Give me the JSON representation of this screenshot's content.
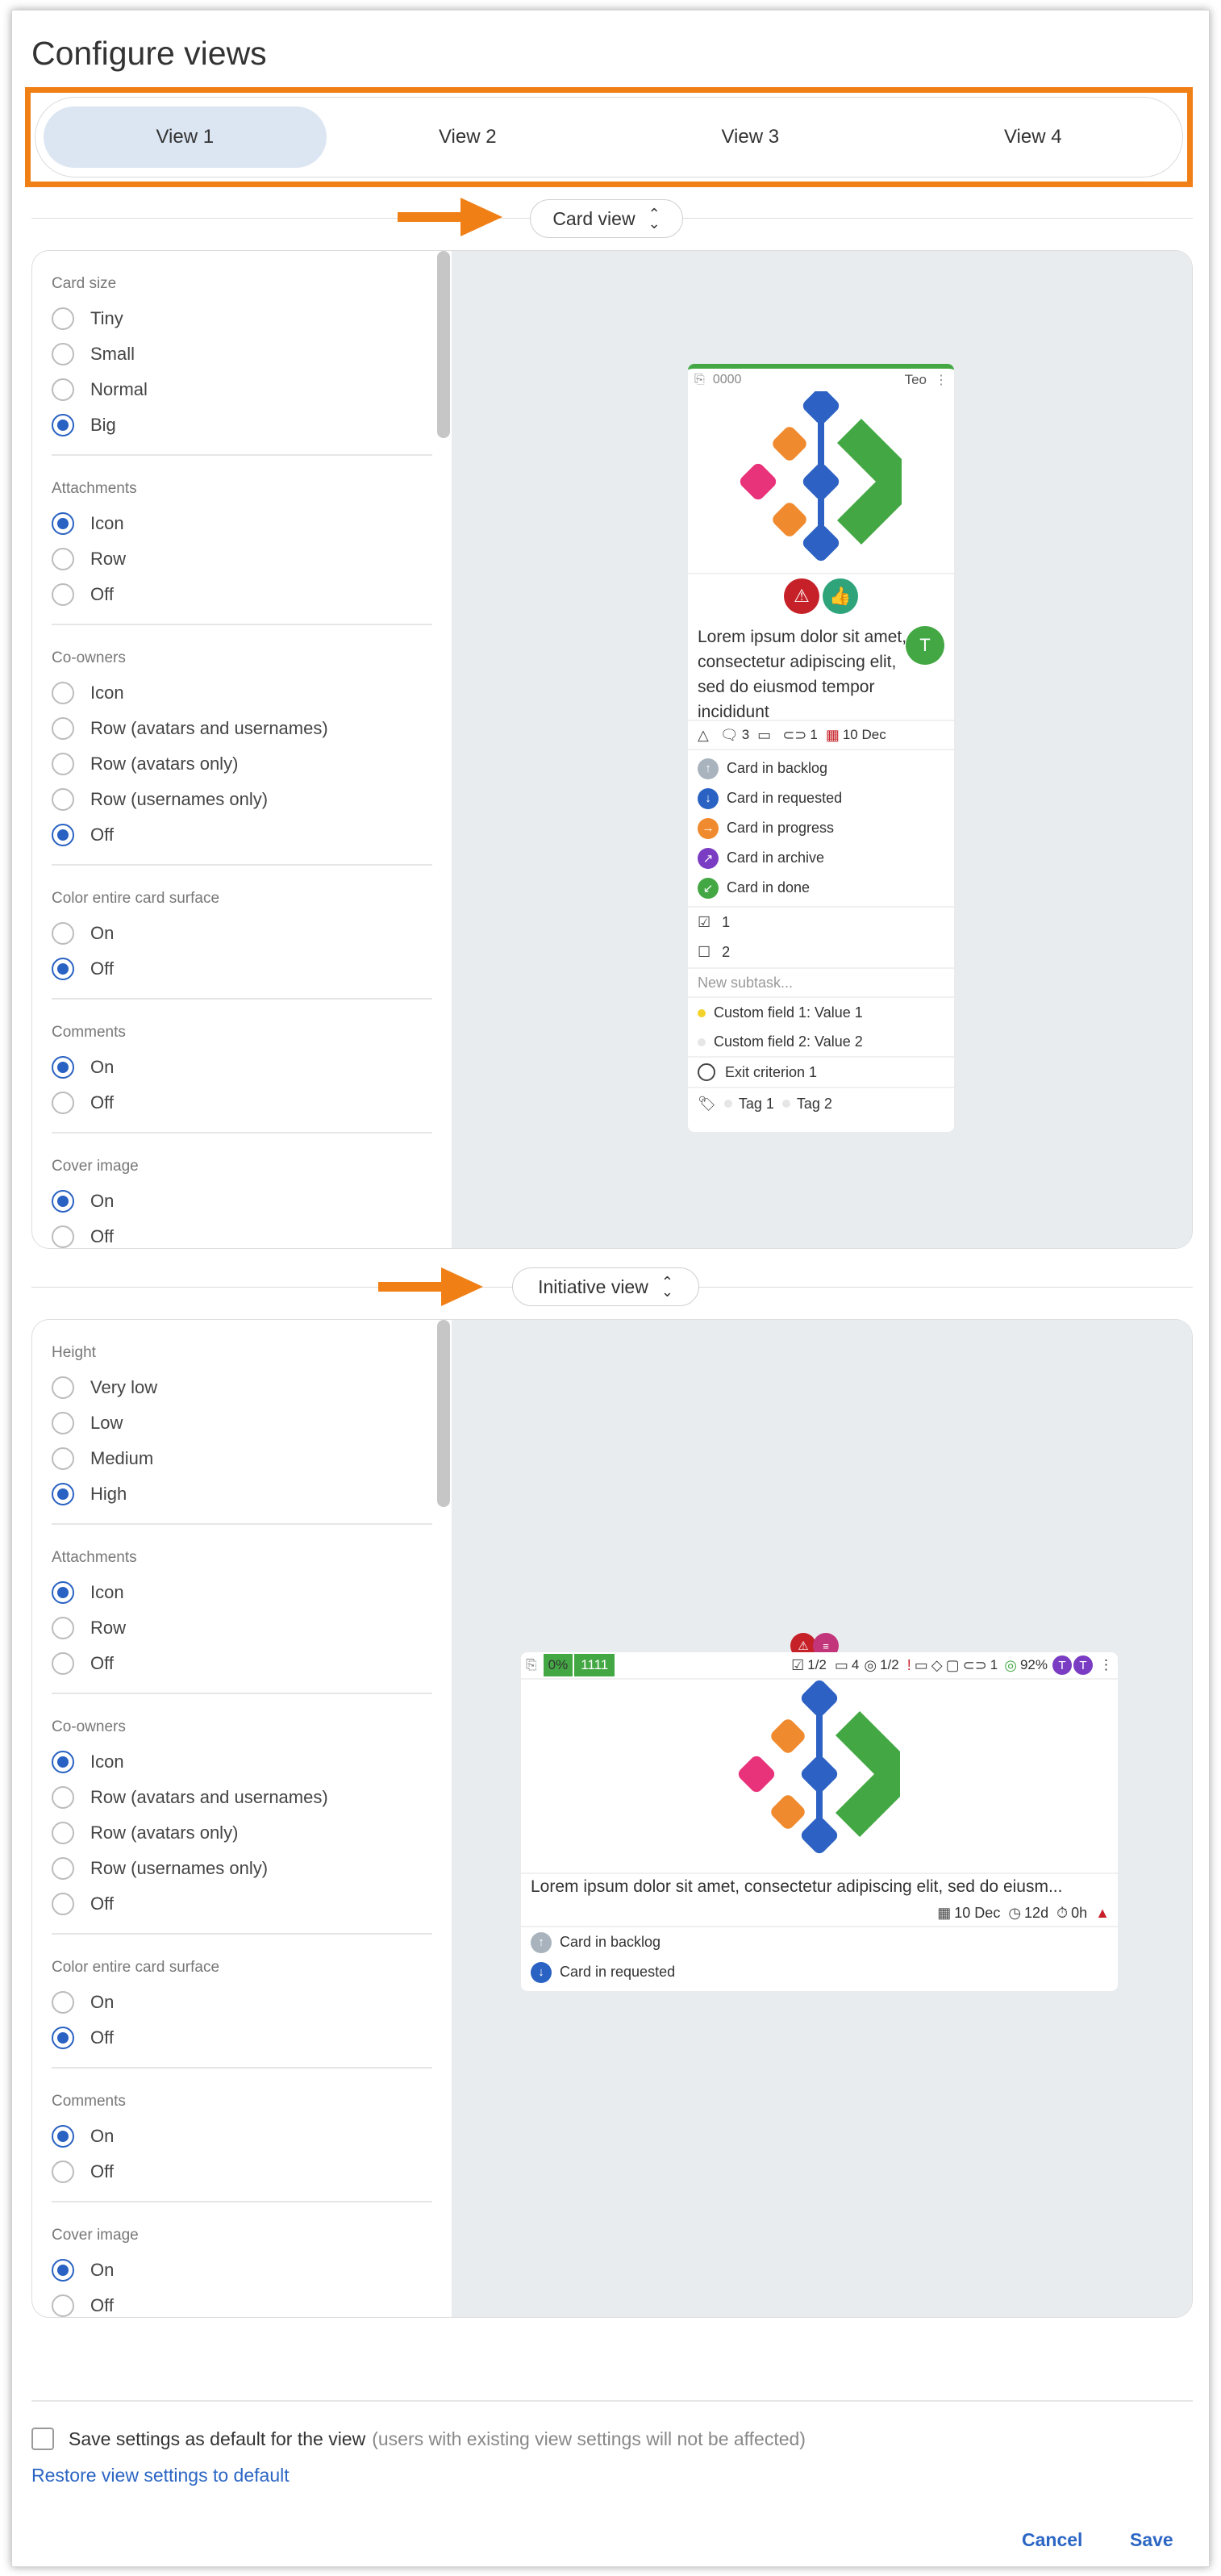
{
  "title": "Configure views",
  "tabs": [
    {
      "label": "View 1",
      "active": true
    },
    {
      "label": "View 2",
      "active": false
    },
    {
      "label": "View 3",
      "active": false
    },
    {
      "label": "View 4",
      "active": false
    }
  ],
  "card_view": {
    "section_label": "Card view",
    "settings": [
      {
        "title": "Card size",
        "options": [
          {
            "label": "Tiny",
            "on": false
          },
          {
            "label": "Small",
            "on": false
          },
          {
            "label": "Normal",
            "on": false
          },
          {
            "label": "Big",
            "on": true
          }
        ]
      },
      {
        "title": "Attachments",
        "options": [
          {
            "label": "Icon",
            "on": true
          },
          {
            "label": "Row",
            "on": false
          },
          {
            "label": "Off",
            "on": false
          }
        ]
      },
      {
        "title": "Co-owners",
        "options": [
          {
            "label": "Icon",
            "on": false
          },
          {
            "label": "Row (avatars and usernames)",
            "on": false
          },
          {
            "label": "Row (avatars only)",
            "on": false
          },
          {
            "label": "Row (usernames only)",
            "on": false
          },
          {
            "label": "Off",
            "on": true
          }
        ]
      },
      {
        "title": "Color entire card surface",
        "options": [
          {
            "label": "On",
            "on": false
          },
          {
            "label": "Off",
            "on": true
          }
        ]
      },
      {
        "title": "Comments",
        "options": [
          {
            "label": "On",
            "on": true
          },
          {
            "label": "Off",
            "on": false
          }
        ]
      },
      {
        "title": "Cover image",
        "options": [
          {
            "label": "On",
            "on": true
          },
          {
            "label": "Off",
            "on": false
          }
        ]
      }
    ],
    "card": {
      "id": "0000",
      "owner": "Teo",
      "avatar": "T",
      "title": "Lorem ipsum dolor sit amet, consectetur adipiscing elit, sed do eiusmod tempor incididunt",
      "comments": "3",
      "attachments": "1",
      "deadline": "10 Dec",
      "statuses": [
        "Card in backlog",
        "Card in requested",
        "Card in progress",
        "Card in archive",
        "Card in done"
      ],
      "subtasks": [
        "1",
        "2"
      ],
      "new_subtask": "New subtask...",
      "custom_fields": [
        "Custom field 1: Value 1",
        "Custom field 2: Value 2"
      ],
      "exit_criterion": "Exit criterion 1",
      "tags": [
        "Tag 1",
        "Tag 2"
      ]
    }
  },
  "initiative_view": {
    "section_label": "Initiative view",
    "settings": [
      {
        "title": "Height",
        "options": [
          {
            "label": "Very low",
            "on": false
          },
          {
            "label": "Low",
            "on": false
          },
          {
            "label": "Medium",
            "on": false
          },
          {
            "label": "High",
            "on": true
          }
        ]
      },
      {
        "title": "Attachments",
        "options": [
          {
            "label": "Icon",
            "on": true
          },
          {
            "label": "Row",
            "on": false
          },
          {
            "label": "Off",
            "on": false
          }
        ]
      },
      {
        "title": "Co-owners",
        "options": [
          {
            "label": "Icon",
            "on": true
          },
          {
            "label": "Row (avatars and usernames)",
            "on": false
          },
          {
            "label": "Row (avatars only)",
            "on": false
          },
          {
            "label": "Row (usernames only)",
            "on": false
          },
          {
            "label": "Off",
            "on": false
          }
        ]
      },
      {
        "title": "Color entire card surface",
        "options": [
          {
            "label": "On",
            "on": false
          },
          {
            "label": "Off",
            "on": true
          }
        ]
      },
      {
        "title": "Comments",
        "options": [
          {
            "label": "On",
            "on": true
          },
          {
            "label": "Off",
            "on": false
          }
        ]
      },
      {
        "title": "Cover image",
        "options": [
          {
            "label": "On",
            "on": true
          },
          {
            "label": "Off",
            "on": false
          }
        ]
      }
    ],
    "card": {
      "progress": "0%",
      "id": "1111",
      "checklist": "1/2",
      "count": "4",
      "subtasks": "1/2",
      "attachments": "1",
      "percent": "92%",
      "avatars": [
        "T",
        "T"
      ],
      "title": "Lorem ipsum dolor sit amet, consectetur adipiscing elit, sed do eiusm...",
      "deadline": "10 Dec",
      "duration": "12d",
      "time": "0h",
      "statuses": [
        "Card in backlog",
        "Card in requested"
      ]
    }
  },
  "footer": {
    "save_default_label": "Save settings as default for the view",
    "save_default_note": "(users with existing view settings will not be affected)",
    "restore_label": "Restore view settings to default",
    "cancel_label": "Cancel",
    "save_label": "Save"
  },
  "colors": {
    "accent": "#2962c2",
    "highlight": "#f07f16",
    "green": "#43a843"
  }
}
